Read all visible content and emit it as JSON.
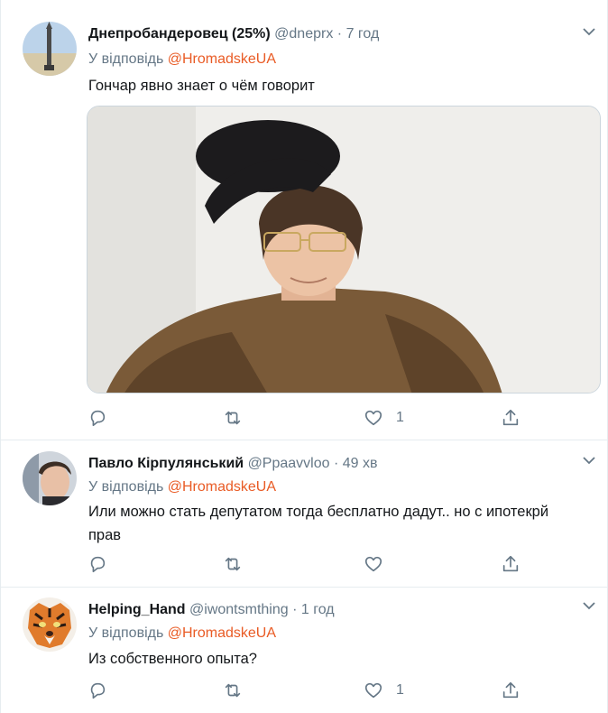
{
  "tweets": [
    {
      "name": "Днепробандеровец (25%)",
      "handle": "@dneprx",
      "dot": "·",
      "time": "7 год",
      "reply_prefix": "У відповідь",
      "reply_to": "@HromadskeUA",
      "text": "Гончар явно знает о чём говорит",
      "has_media": true,
      "like_count": "1"
    },
    {
      "name": "Павло Кірпулянський",
      "handle": "@Ppaavvloo",
      "dot": "·",
      "time": "49 хв",
      "reply_prefix": "У відповідь",
      "reply_to": "@HromadskeUA",
      "text_line1": "Или можно стать депутатом тогда бесплатно дадут.. но с ипотекрй",
      "text_line2": "прав",
      "like_count": ""
    },
    {
      "name": "Helping_Hand",
      "handle": "@iwontsmthing",
      "dot": "·",
      "time": "1 год",
      "reply_prefix": "У відповідь",
      "reply_to": "@HromadskeUA",
      "text": "Из собственного опыта?",
      "like_count": "1"
    }
  ],
  "icons": [
    "reply-icon",
    "retweet-icon",
    "like-icon",
    "share-icon",
    "chevron-down-icon"
  ],
  "colors": {
    "text": "#14171a",
    "muted": "#657786",
    "mention": "#e95b25",
    "border": "#e6ecf0"
  }
}
